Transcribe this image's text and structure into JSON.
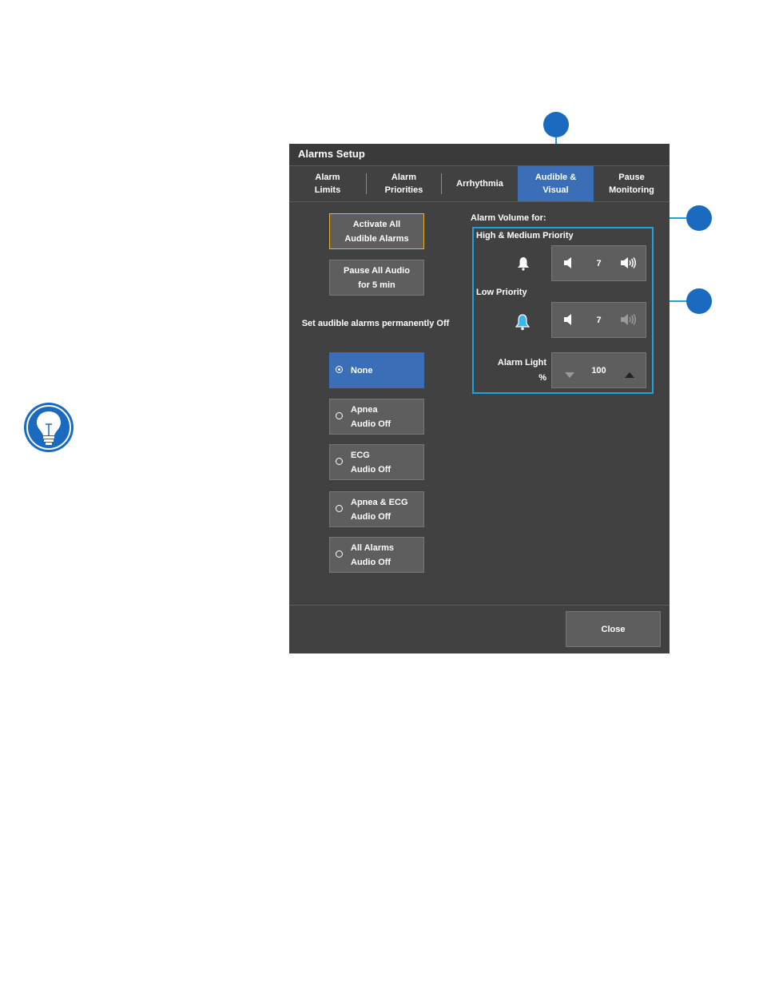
{
  "window": {
    "title": "Alarms Setup"
  },
  "tabs": [
    {
      "label": "Alarm\nLimits",
      "active": false
    },
    {
      "label": "Alarm\nPriorities",
      "active": false
    },
    {
      "label": "Arrhythmia",
      "active": false
    },
    {
      "label": "Audible &\nVisual",
      "active": true
    },
    {
      "label": "Pause\nMonitoring",
      "active": false
    }
  ],
  "left": {
    "activate_button": "Activate All\nAudible Alarms",
    "pause_button": "Pause All Audio\nfor 5 min",
    "permanent_off_label": "Set audible alarms permanently Off",
    "options": [
      {
        "label": "None",
        "selected": true
      },
      {
        "label": "Apnea\nAudio Off",
        "selected": false
      },
      {
        "label": "ECG\nAudio Off",
        "selected": false
      },
      {
        "label": "Apnea & ECG\nAudio Off",
        "selected": false
      },
      {
        "label": "All Alarms\nAudio Off",
        "selected": false
      }
    ]
  },
  "right": {
    "volume_heading": "Alarm Volume for:",
    "high_medium_label": "High & Medium Priority",
    "high_medium_volume": "7",
    "low_label": "Low Priority",
    "low_volume": "7",
    "alarm_light_label": "Alarm Light\n%",
    "alarm_light_value": "100"
  },
  "footer": {
    "close_button": "Close"
  },
  "colors": {
    "accent": "#3a6fb7",
    "callout": "#1a6bc0",
    "highlight_box": "#1ba3e0",
    "activate_border": "#e2b62c",
    "low_bell": "#3ab6e8"
  },
  "icons": [
    "lightbulb-icon",
    "bell-icon",
    "speaker-low-icon",
    "speaker-high-icon",
    "triangle-down-icon",
    "triangle-up-icon"
  ]
}
